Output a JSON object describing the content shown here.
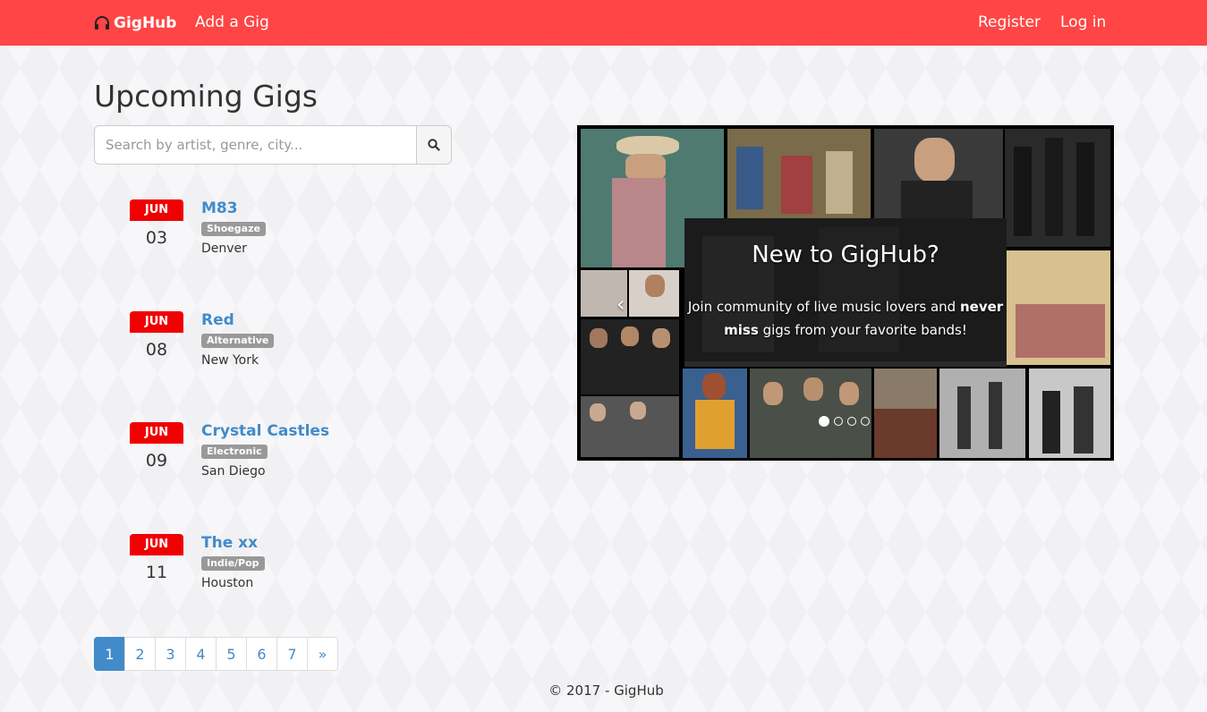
{
  "navbar": {
    "brand": "GigHub",
    "brand_icon": "headphones-icon",
    "add_gig": "Add a Gig",
    "register": "Register",
    "login": "Log in",
    "color": "#ff4545"
  },
  "main": {
    "title": "Upcoming Gigs",
    "search": {
      "placeholder": "Search by artist, genre, city...",
      "value": "",
      "button_icon": "search-icon"
    }
  },
  "gigs": [
    {
      "month": "JUN",
      "day": "03",
      "artist": "M83",
      "genre": "Shoegaze",
      "city": "Denver"
    },
    {
      "month": "JUN",
      "day": "08",
      "artist": "Red",
      "genre": "Alternative",
      "city": "New York"
    },
    {
      "month": "JUN",
      "day": "09",
      "artist": "Crystal Castles",
      "genre": "Electronic",
      "city": "San Diego"
    },
    {
      "month": "JUN",
      "day": "11",
      "artist": "The xx",
      "genre": "Indie/Pop",
      "city": "Houston"
    }
  ],
  "pagination": {
    "pages": [
      "1",
      "2",
      "3",
      "4",
      "5",
      "6",
      "7"
    ],
    "next": "»",
    "active": "1"
  },
  "carousel": {
    "title": "New to GigHub?",
    "text_part1": "Join community of live music lovers and ",
    "text_bold1": "never miss",
    "text_part2": " gigs from your favorite bands!",
    "prev_icon": "chevron-left-icon",
    "slide_count": 4,
    "active_slide": 1
  },
  "footer": {
    "text": "© 2017 - GigHub"
  },
  "colors": {
    "accent": "#ff4545",
    "calendar": "#f00000",
    "link": "#428bca",
    "badge": "#999999"
  }
}
